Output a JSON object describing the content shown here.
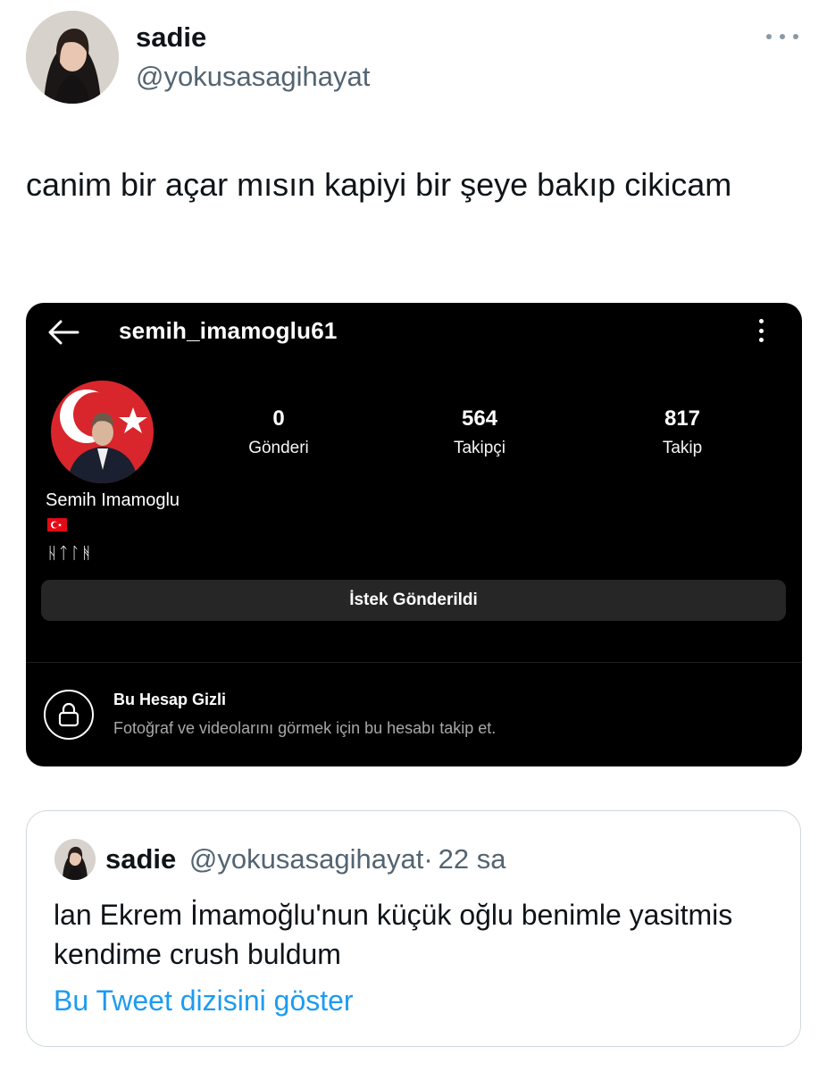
{
  "tweet": {
    "author_name": "sadie",
    "author_handle": "@yokusasagihayat",
    "text": "canim bir açar mısın kapiyi bir şeye bakıp cikicam"
  },
  "instagram": {
    "username": "semih_imamoglu61",
    "stats": [
      {
        "value": "0",
        "label": "Gönderi"
      },
      {
        "value": "564",
        "label": "Takipçi"
      },
      {
        "value": "817",
        "label": "Takip"
      }
    ],
    "full_name": "Semih Imamoglu",
    "bio": "ᚺᛏᛚᚻ",
    "request_button": "İstek Gönderildi",
    "private_title": "Bu Hesap Gizli",
    "private_desc": "Fotoğraf ve videolarını görmek için bu hesabı takip et."
  },
  "quoted": {
    "author_name": "sadie",
    "author_handle": "@yokusasagihayat",
    "separator": "·",
    "time": "22 sa",
    "text": "lan Ekrem İmamoğlu'nun küçük oğlu benimle yasitmis kendime crush buldum",
    "thread_link": "Bu Tweet dizisini göster"
  },
  "colors": {
    "secondary_text": "#536471",
    "link": "#1d9bf0",
    "ig_background": "#000000",
    "ig_button": "#262626",
    "flag_red": "#e30a17"
  },
  "icons": [
    "more-horizontal-icon",
    "back-arrow-icon",
    "more-vertical-icon",
    "lock-icon",
    "turkish-flag-icon"
  ]
}
